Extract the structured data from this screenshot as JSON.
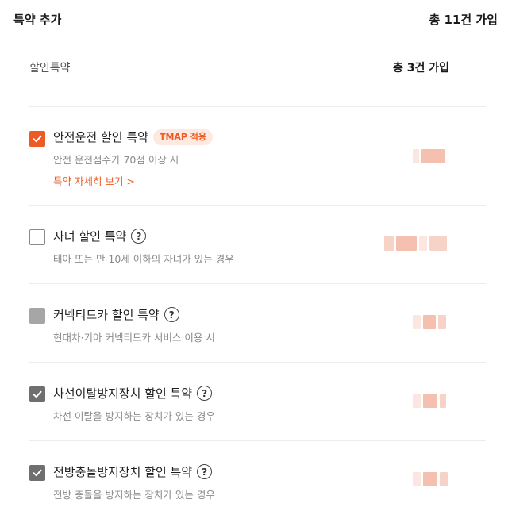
{
  "header": {
    "title": "특약 추가",
    "total": "총 11건 가입"
  },
  "discount": {
    "label": "할인특약",
    "count": "총 3건 가입"
  },
  "items": [
    {
      "name": "안전운전 할인 특약",
      "badge": "TMAP 적용",
      "desc": "안전 운전점수가 70점 이상 시",
      "link": "특약 자세히 보기 >",
      "checked": true,
      "state": "orange-checked",
      "price_hidden": true
    },
    {
      "name": "자녀 할인 특약",
      "desc": "태아 또는 만 10세 이하의 자녀가 있는 경우",
      "checked": false,
      "state": "unchecked",
      "help": "?",
      "price_hidden": true
    },
    {
      "name": "커넥티드카 할인 특약",
      "desc": "현대차·기아 커넥티드카 서비스 이용 시",
      "checked": false,
      "state": "disabled",
      "help": "?",
      "price_hidden": true
    },
    {
      "name": "차선이탈방지장치 할인 특약",
      "desc": "차선 이탈을 방지하는 장치가 있는 경우",
      "checked": true,
      "state": "gray-checked",
      "help": "?",
      "price_hidden": true
    },
    {
      "name": "전방충돌방지장치 할인 특약",
      "desc": "전방 충돌을 방지하는 장치가 있는 경우",
      "checked": true,
      "state": "gray-checked",
      "help": "?",
      "price_hidden": true
    }
  ],
  "icons": {
    "checkmark": "check-icon",
    "help": "question-circle-icon"
  },
  "colors": {
    "accent": "#ee5a24",
    "checked_gray": "#6f6f6f",
    "disabled": "#a6a6a6",
    "badge_bg": "#fde9df"
  }
}
